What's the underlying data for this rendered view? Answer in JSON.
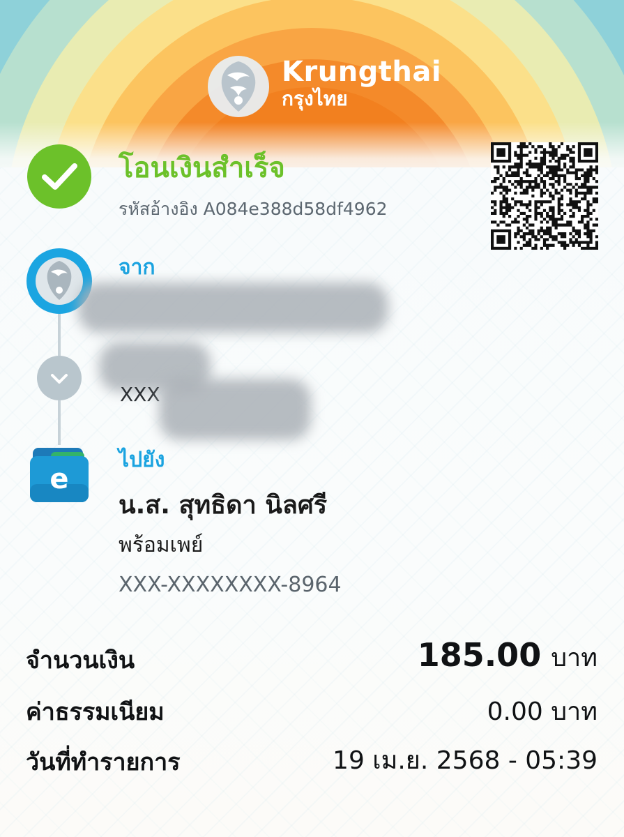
{
  "header": {
    "brand_name": "Krungthai",
    "brand_name_thai": "กรุงไทย"
  },
  "status": {
    "title": "โอนเงินสำเร็จ",
    "reference_label": "รหัสอ้างอิง",
    "reference_code": "A084e388d58df4962",
    "icon": "check-circle-icon"
  },
  "from": {
    "label": "จาก",
    "partial_text": "XXX",
    "icon": "krungthai-logo-icon"
  },
  "to": {
    "label": "ไปยัง",
    "name": "น.ส. สุทธิดา นิลศรี",
    "service": "พร้อมเพย์",
    "account": "XXX-XXXXXXXX-8964",
    "icon": "e-wallet-icon"
  },
  "summary": {
    "amount_label": "จำนวนเงิน",
    "amount_value": "185.00",
    "amount_unit": "บาท",
    "fee_label": "ค่าธรรมเนียม",
    "fee_value": "0.00 บาท",
    "date_label": "วันที่ทำรายการ",
    "date_value": "19 เม.ย. 2568 - 05:39"
  },
  "colors": {
    "success_green": "#6cc12a",
    "label_blue": "#1aa3e0",
    "brand_blue": "#1ba5e1"
  }
}
